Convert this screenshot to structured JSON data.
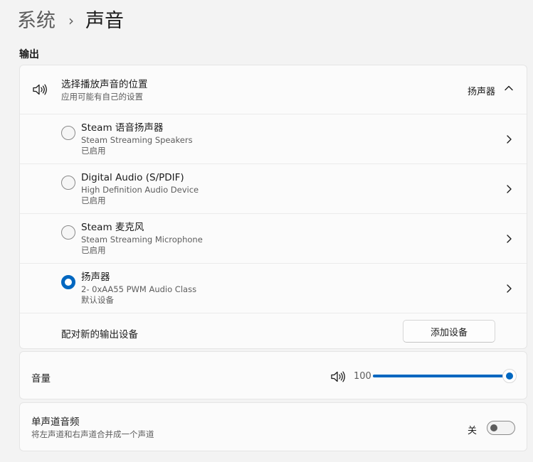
{
  "breadcrumb": {
    "parent": "系统",
    "separator": "›",
    "current": "声音"
  },
  "output": {
    "section_title": "输出",
    "location": {
      "title": "选择播放声音的位置",
      "subtitle": "应用可能有自己的设置",
      "selected": "扬声器",
      "expanded": true
    },
    "devices": [
      {
        "name": "Steam 语音扬声器",
        "description": "Steam Streaming Speakers",
        "status": "已启用",
        "selected": false
      },
      {
        "name": "Digital Audio (S/PDIF)",
        "description": "High Definition Audio Device",
        "status": "已启用",
        "selected": false
      },
      {
        "name": "Steam 麦克风",
        "description": "Steam Streaming Microphone",
        "status": "已启用",
        "selected": false
      },
      {
        "name": "扬声器",
        "description": "2- 0xAA55 PWM Audio Class",
        "status": "默认设备",
        "selected": true
      }
    ],
    "pair": {
      "label": "配对新的输出设备",
      "button": "添加设备"
    }
  },
  "volume": {
    "label": "音量",
    "value": "100",
    "level": 1.0
  },
  "mono": {
    "title": "单声道音频",
    "subtitle": "将左声道和右声道合并成一个声道",
    "state_label": "关",
    "on": false
  },
  "colors": {
    "accent": "#0067c0",
    "background": "#f3f3f3",
    "card": "#fbfbfb"
  },
  "icons": {
    "speaker": "speaker-icon",
    "chevron_up": "chevron-up-icon",
    "chevron_right": "chevron-right-icon"
  }
}
